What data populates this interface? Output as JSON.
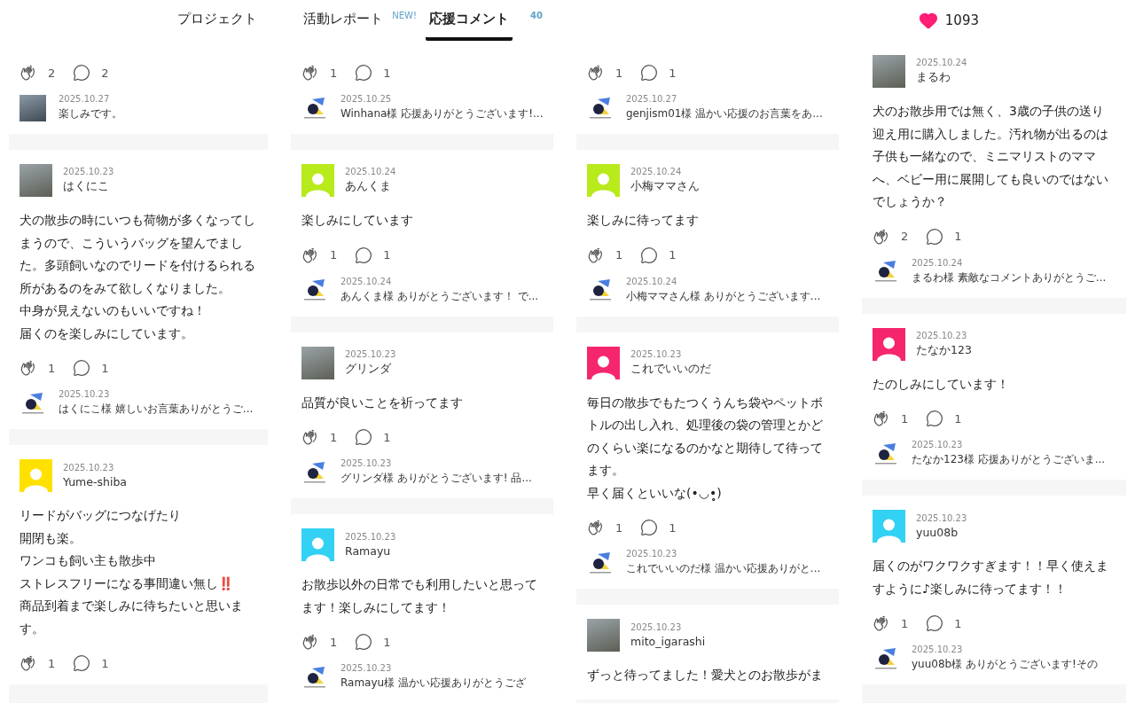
{
  "tabs": [
    {
      "label": "プロジェクト",
      "selected": false
    },
    {
      "label": "活動レポート",
      "badge": "NEW!",
      "selected": false
    },
    {
      "label": "応援コメント",
      "badge": "40",
      "selected": true
    }
  ],
  "likes": "1093",
  "columns": [
    {
      "cards": [
        {
          "claps": "2",
          "comments": "2",
          "reply": {
            "kind": "photo",
            "date": "2025.10.27",
            "text": "楽しみです。"
          }
        },
        {
          "avatar": {
            "kind": "photo"
          },
          "date": "2025.10.23",
          "name": "はくにこ",
          "body": [
            "犬の散歩の時にいつも荷物が多くなってしまうので、こういうバッグを望んでました。多頭飼いなのでリードを付けるられる所があるのをみて欲しくなりました。",
            "中身が見えないのもいいですね！",
            "届くのを楽しみにしています。"
          ],
          "claps": "1",
          "comments": "1",
          "reply": {
            "kind": "logo",
            "date": "2025.10.23",
            "text": "はくにこ様 嬉しいお言葉ありがとうご..."
          }
        },
        {
          "avatar": {
            "kind": "default",
            "color": "#ffe100"
          },
          "date": "2025.10.23",
          "name": "Yume-shiba",
          "body": [
            "リードがバッグにつなげたり",
            "開閉も楽。",
            "ワンコも飼い主も散歩中",
            "ストレスフリーになる事間違い無し**‼️**",
            "商品到着まで楽しみに待ちたいと思います。"
          ],
          "claps": "1",
          "comments": "1"
        }
      ]
    },
    {
      "cards": [
        {
          "claps": "1",
          "comments": "1",
          "reply": {
            "kind": "logo",
            "date": "2025.10.25",
            "text": "Winhana様 応援ありがとうございます!..."
          }
        },
        {
          "avatar": {
            "kind": "default",
            "color": "#b8ea1c"
          },
          "date": "2025.10.24",
          "name": "あんくま",
          "body": [
            "楽しみにしています"
          ],
          "claps": "1",
          "comments": "1",
          "reply": {
            "kind": "logo",
            "date": "2025.10.24",
            "text": "あんくま様 ありがとうございます！ で..."
          }
        },
        {
          "avatar": {
            "kind": "photo"
          },
          "date": "2025.10.23",
          "name": "グリンダ",
          "body": [
            "品質が良いことを祈ってます"
          ],
          "claps": "1",
          "comments": "1",
          "reply": {
            "kind": "logo",
            "date": "2025.10.23",
            "text": "グリンダ様 ありがとうございます! 品..."
          }
        },
        {
          "avatar": {
            "kind": "default",
            "color": "#33d1f3"
          },
          "date": "2025.10.23",
          "name": "Ramayu",
          "body": [
            "お散歩以外の日常でも利用したいと思ってます！楽しみにしてます！"
          ],
          "claps": "1",
          "comments": "1",
          "reply": {
            "kind": "logo",
            "date": "2025.10.23",
            "text": "Ramayu様 温かい応援ありがとうござ"
          }
        }
      ]
    },
    {
      "cards": [
        {
          "claps": "1",
          "comments": "1",
          "reply": {
            "kind": "logo",
            "date": "2025.10.27",
            "text": "genjism01様 温かい応援のお言葉をあ..."
          }
        },
        {
          "avatar": {
            "kind": "default",
            "color": "#b8ea1c"
          },
          "date": "2025.10.24",
          "name": "小梅ママさん",
          "body": [
            "楽しみに待ってます"
          ],
          "claps": "1",
          "comments": "1",
          "reply": {
            "kind": "logo",
            "date": "2025.10.24",
            "text": "小梅ママさん様 ありがとうございます..."
          }
        },
        {
          "avatar": {
            "kind": "default",
            "color": "#f5266e"
          },
          "date": "2025.10.23",
          "name": "これでいいのだ",
          "body": [
            "毎日の散歩でもたつくうんち袋やペットボトルの出し入れ、処理後の袋の管理とかどのくらい楽になるのかなと期待して待ってます。",
            "早く届くといいな(•◡•̥̥)"
          ],
          "claps": "1",
          "comments": "1",
          "reply": {
            "kind": "logo",
            "date": "2025.10.23",
            "text": "これでいいのだ様 温かい応援ありがと..."
          }
        },
        {
          "avatar": {
            "kind": "photo"
          },
          "date": "2025.10.23",
          "name": "mito_igarashi",
          "body": [
            "ずっと待ってました！愛犬とのお散歩がま"
          ]
        }
      ]
    },
    {
      "cards": [
        {
          "avatar": {
            "kind": "photo"
          },
          "date": "2025.10.24",
          "name": "まるわ",
          "body": [
            "犬のお散歩用では無く、3歳の子供の送り迎え用に購入しました。汚れ物が出るのは子供も一緒なので、ミニマリストのママへ、ベビー用に展開しても良いのではないでしょうか？"
          ],
          "claps": "2",
          "comments": "1",
          "reply": {
            "kind": "logo",
            "date": "2025.10.24",
            "text": "まるわ様 素敵なコメントありがとうご..."
          }
        },
        {
          "avatar": {
            "kind": "default",
            "color": "#f5266e"
          },
          "date": "2025.10.23",
          "name": "たなか123",
          "body": [
            "たのしみにしています！"
          ],
          "claps": "1",
          "comments": "1",
          "reply": {
            "kind": "logo",
            "date": "2025.10.23",
            "text": "たなか123様 応援ありがとうございま..."
          }
        },
        {
          "avatar": {
            "kind": "default",
            "color": "#33d1f3"
          },
          "date": "2025.10.23",
          "name": "yuu08b",
          "body": [
            "届くのがワクワクすぎます！！早く使えますように♪楽しみに待ってます！！"
          ],
          "claps": "1",
          "comments": "1",
          "reply": {
            "kind": "logo",
            "date": "2025.10.23",
            "text": "yuu08b様 ありがとうございます!その"
          }
        }
      ]
    }
  ]
}
